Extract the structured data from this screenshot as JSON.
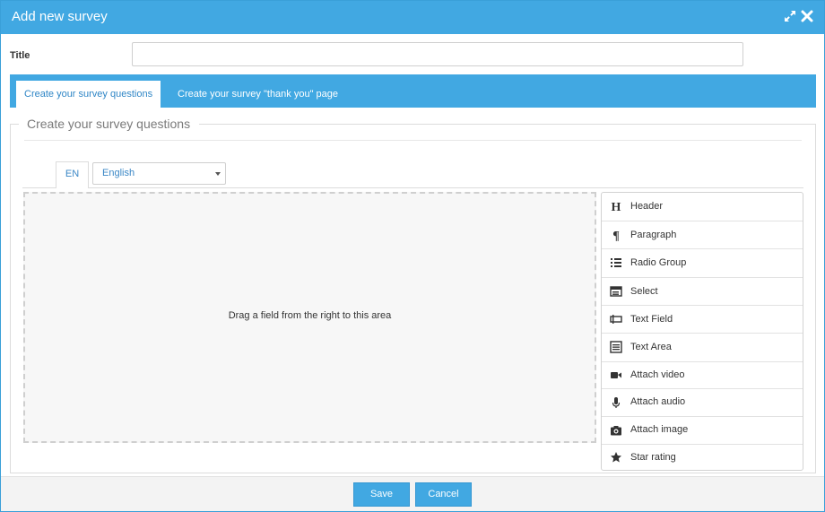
{
  "dialog": {
    "title": "Add new survey"
  },
  "form": {
    "title_label": "Title",
    "title_value": ""
  },
  "tabs": [
    {
      "label": "Create your survey questions",
      "active": true
    },
    {
      "label": "Create your survey \"thank you\" page",
      "active": false
    }
  ],
  "section": {
    "legend": "Create your survey questions"
  },
  "language": {
    "tab": "EN",
    "selected": "English"
  },
  "dropzone": {
    "message": "Drag a field from the right to this area"
  },
  "fields": [
    {
      "label": "Header",
      "icon": "header-icon"
    },
    {
      "label": "Paragraph",
      "icon": "paragraph-icon"
    },
    {
      "label": "Radio Group",
      "icon": "radio-group-icon"
    },
    {
      "label": "Select",
      "icon": "select-icon"
    },
    {
      "label": "Text Field",
      "icon": "text-field-icon"
    },
    {
      "label": "Text Area",
      "icon": "text-area-icon"
    },
    {
      "label": "Attach video",
      "icon": "video-camera-icon"
    },
    {
      "label": "Attach audio",
      "icon": "microphone-icon"
    },
    {
      "label": "Attach image",
      "icon": "camera-icon"
    },
    {
      "label": "Star rating",
      "icon": "star-icon"
    }
  ],
  "footer": {
    "save_label": "Save",
    "cancel_label": "Cancel"
  },
  "colors": {
    "accent": "#41a8e2",
    "link": "#2f86c6"
  }
}
